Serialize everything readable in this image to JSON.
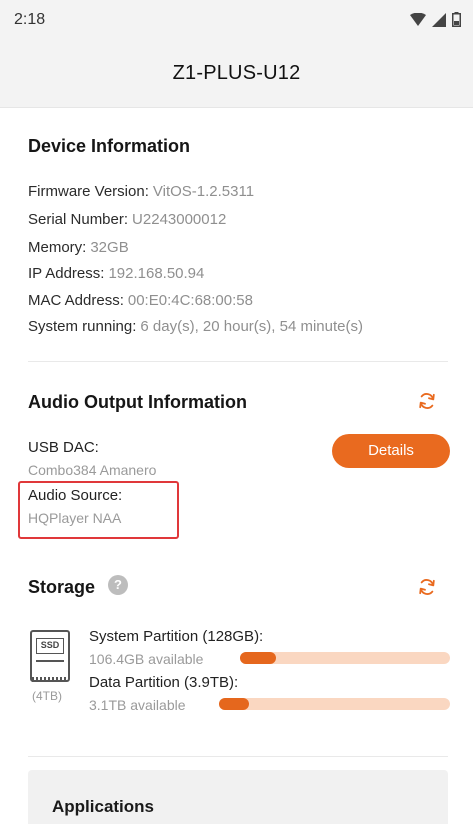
{
  "status_bar": {
    "time": "2:18"
  },
  "app_bar": {
    "title": "Z1-PLUS-U12"
  },
  "device_info": {
    "title": "Device Information",
    "rows": [
      {
        "label": "Firmware Version:",
        "value": "VitOS-1.2.5311"
      },
      {
        "label": "Serial Number:",
        "value": "U2243000012"
      },
      {
        "label": "Memory:",
        "value": "32GB"
      },
      {
        "label": "IP Address:",
        "value": "192.168.50.94"
      },
      {
        "label": "MAC Address:",
        "value": "00:E0:4C:68:00:58"
      },
      {
        "label": "System running:",
        "value": "6 day(s), 20 hour(s), 54 minute(s)"
      }
    ]
  },
  "audio_output": {
    "title": "Audio Output Information",
    "usb_dac_label": "USB DAC:",
    "usb_dac_value": "Combo384 Amanero",
    "audio_source_label": "Audio Source:",
    "audio_source_value": "HQPlayer NAA",
    "details_button": "Details"
  },
  "storage": {
    "title": "Storage",
    "help_symbol": "?",
    "drive_label": "SSD",
    "drive_capacity": "(4TB)",
    "partitions": [
      {
        "name": "System Partition (128GB):",
        "available": "106.4GB available",
        "used_fraction": 0.17
      },
      {
        "name": "Data Partition (3.9TB):",
        "available": "3.1TB available",
        "used_fraction": 0.13
      }
    ]
  },
  "applications": {
    "title": "Applications"
  },
  "colors": {
    "accent": "#e96a1f",
    "bar_track": "#fad7c1",
    "highlight": "#e0383a"
  },
  "icons": {
    "refresh": "refresh-icon",
    "ssd": "ssd-drive-icon",
    "help": "help-icon"
  }
}
